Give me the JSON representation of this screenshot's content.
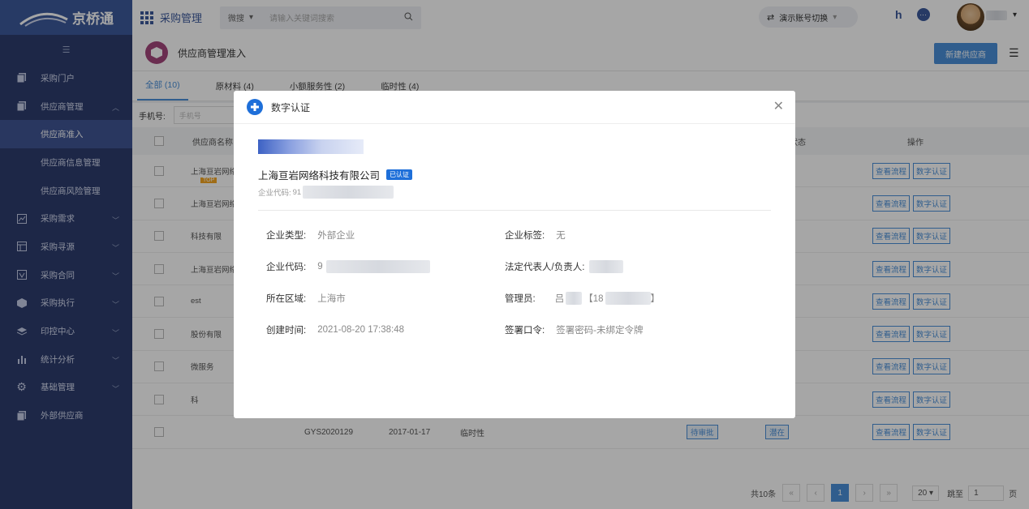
{
  "sidebar": {
    "logo_text": "京桥通",
    "items": [
      {
        "label": "采购门户",
        "icon": "document-icon"
      },
      {
        "label": "供应商管理",
        "icon": "document-icon"
      },
      {
        "label": "供应商准入"
      },
      {
        "label": "供应商信息管理"
      },
      {
        "label": "供应商风险管理"
      },
      {
        "label": "采购需求",
        "icon": "chart-icon"
      },
      {
        "label": "采购寻源",
        "icon": "table-icon"
      },
      {
        "label": "采购合同",
        "icon": "contract-icon"
      },
      {
        "label": "采购执行",
        "icon": "cube-icon"
      },
      {
        "label": "印控中心",
        "icon": "layers-icon"
      },
      {
        "label": "统计分析",
        "icon": "bar-chart-icon"
      },
      {
        "label": "基础管理",
        "icon": "gear-icon"
      },
      {
        "label": "外部供应商",
        "icon": "document-icon"
      }
    ]
  },
  "topbar": {
    "app_title": "采购管理",
    "search_scope": "微搜",
    "search_placeholder": "请输入关键词搜索",
    "account_switch": "演示账号切换"
  },
  "page": {
    "title": "供应商管理准入",
    "new_button": "新建供应商",
    "tabs": [
      "全部 (10)",
      "原材料 (4)",
      "小额服务性 (2)",
      "临时性 (4)"
    ],
    "filter_label": "手机号:",
    "filter_placeholder": "手机号",
    "columns": {
      "name": "供应商名称",
      "status": "状态",
      "ops": "操作"
    },
    "rows": [
      {
        "name": "上海亘岩网络",
        "tag": "TOP"
      },
      {
        "name": "上海亘岩网络"
      },
      {
        "name": "科技有限"
      },
      {
        "name": "上海亘岩网络"
      },
      {
        "name": "est"
      },
      {
        "name": "股份有限"
      },
      {
        "name": "微服务"
      },
      {
        "name": "科"
      },
      {
        "name": "",
        "code": "GYS2020129",
        "date": "2017-01-17",
        "type": "临时性",
        "status1": "待审批",
        "status2": "潜在"
      }
    ],
    "op_view": "查看流程",
    "op_cert": "数字认证",
    "pager": {
      "total": "共10条",
      "current": "1",
      "page_size": "20",
      "goto_label": "跳至",
      "goto_value": "1",
      "page_unit": "页"
    }
  },
  "modal": {
    "title": "数字认证",
    "company": "上海亘岩网络科技有限公司",
    "badge": "已认证",
    "code_label": "企业代码:",
    "code_prefix": "91",
    "fields": {
      "type_label": "企业类型:",
      "type_value": "外部企业",
      "tag_label": "企业标签:",
      "tag_value": "无",
      "code_label": "企业代码:",
      "code_value": "9",
      "legal_label": "法定代表人/负责人:",
      "region_label": "所在区域:",
      "region_value": "上海市",
      "admin_label": "管理员:",
      "admin_value_a": "吕",
      "admin_value_b": "【18",
      "admin_value_c": "】",
      "created_label": "创建时间:",
      "created_value": "2021-08-20 17:38:48",
      "sign_label": "签署口令:",
      "sign_value": "签署密码-未绑定令牌"
    }
  }
}
